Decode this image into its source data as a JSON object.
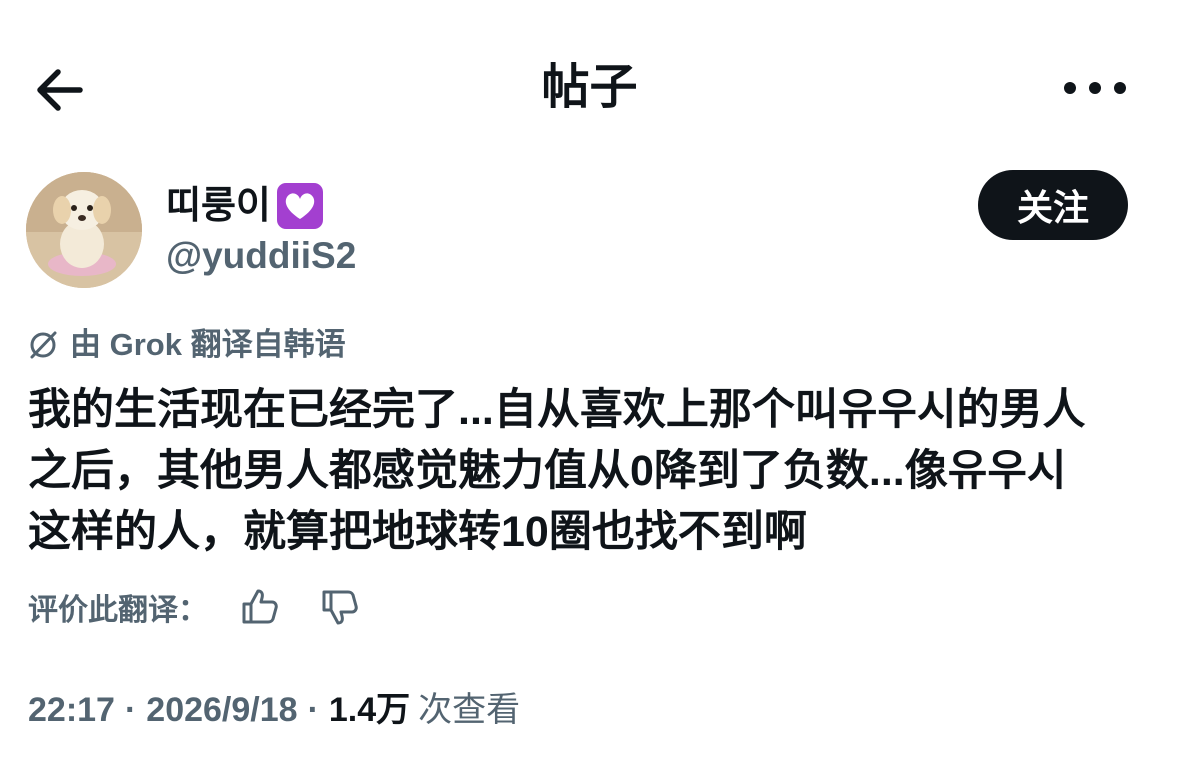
{
  "header": {
    "title": "帖子",
    "back_icon": "arrow-left-icon",
    "more_icon": "more-horizontal-icon"
  },
  "author": {
    "display_name": "띠룽이",
    "badge_icon": "purple-heart-icon",
    "handle": "@yuddiiS2",
    "follow_label": "关注"
  },
  "translation": {
    "icon": "grok-icon",
    "label": "由 Grok 翻译自韩语",
    "rate_label": "评价此翻译："
  },
  "post": {
    "text": "我的生活现在已经完了...自从喜欢上那个叫유우시的男人\n之后，其他男人都感觉魅力值从0降到了负数...像유우시\n这样的人，就算把地球转10圈也找不到啊"
  },
  "meta": {
    "time": "22:17",
    "date": "2026/9/18",
    "views_count": "1.4万",
    "views_label": "次查看"
  },
  "colors": {
    "text": "#0f1419",
    "secondary": "#536471",
    "button_bg": "#0f1419",
    "badge": "#a33fd0"
  }
}
